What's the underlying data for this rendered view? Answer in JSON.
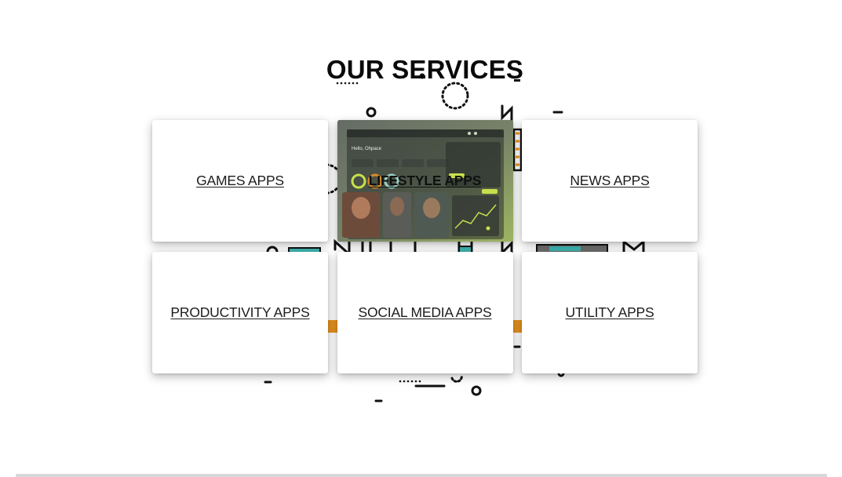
{
  "section": {
    "title": "OUR SERVICES"
  },
  "services": [
    {
      "label": "GAMES APPS"
    },
    {
      "label": "LIFESTYLE APPS"
    },
    {
      "label": "NEWS APPS"
    },
    {
      "label": "PRODUCTIVITY APPS"
    },
    {
      "label": "SOCIAL MEDIA APPS"
    },
    {
      "label": "UTILITY APPS"
    }
  ],
  "featured_preview": {
    "greeting": "Hello, Ohpace"
  },
  "colors": {
    "accent_orange": "#e8921e",
    "accent_teal": "#3fb6b1",
    "preview_green": "#a7c64a",
    "text": "#1c1c1c"
  },
  "icons": [
    "decorative-geometric-shapes"
  ]
}
